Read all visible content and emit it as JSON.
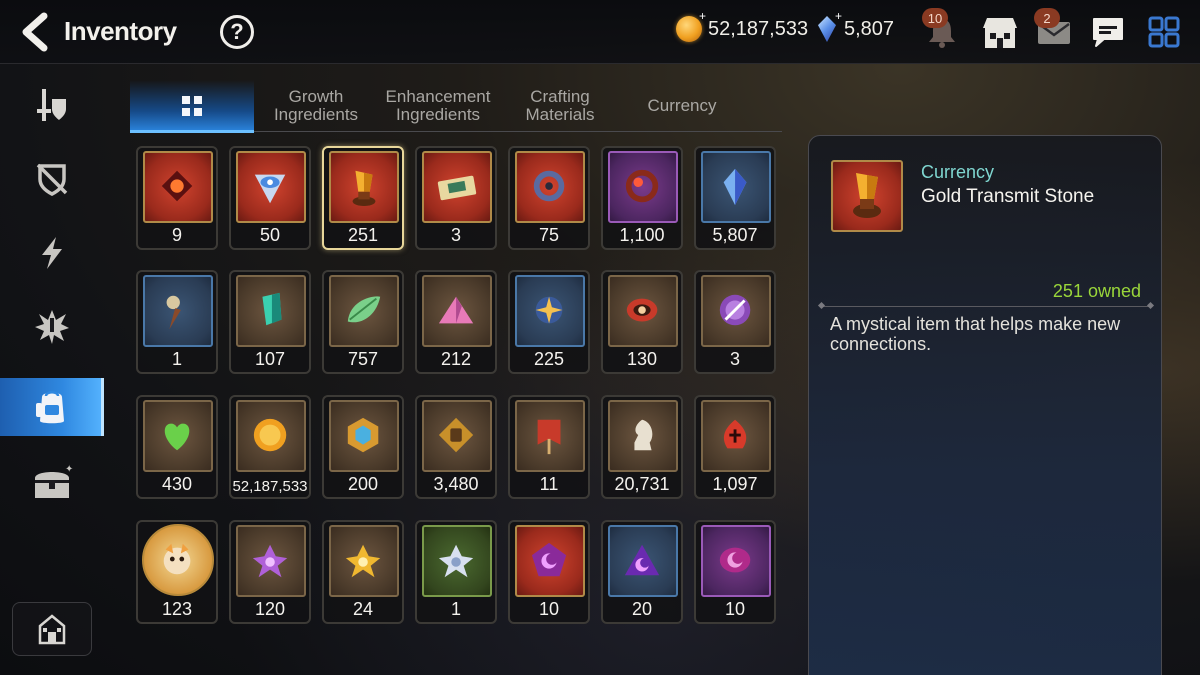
{
  "header": {
    "title": "Inventory",
    "help_label": "?",
    "gold": "52,187,533",
    "crystals": "5,807",
    "notifications_badge": "10",
    "mail_badge": "2",
    "icons": [
      "back-arrow-icon",
      "help-icon",
      "gold-coin-icon",
      "crystal-icon",
      "bell-icon",
      "shop-icon",
      "mail-icon",
      "chat-icon",
      "menu-grid-icon"
    ]
  },
  "sidebar": {
    "items": [
      {
        "icon": "sword-shield-icon"
      },
      {
        "icon": "broken-shield-icon"
      },
      {
        "icon": "lightning-icon"
      },
      {
        "icon": "burst-icon"
      },
      {
        "icon": "backpack-icon",
        "active": true
      },
      {
        "icon": "treasure-chest-icon"
      }
    ],
    "home_icon": "castle-icon"
  },
  "tabs": [
    {
      "label": "",
      "icon": "all-grid-icon",
      "active": true
    },
    {
      "label": "Growth\nIngredients"
    },
    {
      "label": "Enhancement\nIngredients"
    },
    {
      "label": "Crafting\nMaterials"
    },
    {
      "label": "Currency"
    }
  ],
  "items": [
    {
      "qty": "9",
      "frame": "red",
      "icon": "red-rune-icon"
    },
    {
      "qty": "50",
      "frame": "red",
      "icon": "eye-emblem-icon"
    },
    {
      "qty": "251",
      "frame": "red",
      "icon": "gold-transmit-stone-icon",
      "selected": true
    },
    {
      "qty": "3",
      "frame": "red",
      "icon": "ticket-icon"
    },
    {
      "qty": "75",
      "frame": "red",
      "icon": "ring-pendant-icon"
    },
    {
      "qty": "1,100",
      "frame": "purple",
      "icon": "flower-ring-icon"
    },
    {
      "qty": "5,807",
      "frame": "blue",
      "icon": "crystal-icon"
    },
    {
      "qty": "1",
      "frame": "blue",
      "icon": "compass-dagger-icon"
    },
    {
      "qty": "107",
      "frame": "brown",
      "icon": "teal-crystal-icon"
    },
    {
      "qty": "757",
      "frame": "brown",
      "icon": "leaf-icon"
    },
    {
      "qty": "212",
      "frame": "brown",
      "icon": "pink-mountain-icon"
    },
    {
      "qty": "225",
      "frame": "blue",
      "icon": "star-amulet-icon"
    },
    {
      "qty": "130",
      "frame": "brown",
      "icon": "red-bracelet-icon"
    },
    {
      "qty": "3",
      "frame": "brown",
      "icon": "purple-seal-icon"
    },
    {
      "qty": "430",
      "frame": "brown",
      "icon": "green-heart-icon"
    },
    {
      "qty": "52,187,533",
      "frame": "brown",
      "icon": "gold-sun-coin-icon",
      "small": true
    },
    {
      "qty": "200",
      "frame": "brown",
      "icon": "gold-hex-emblem-icon"
    },
    {
      "qty": "3,480",
      "frame": "brown",
      "icon": "fist-badge-icon"
    },
    {
      "qty": "11",
      "frame": "brown",
      "icon": "banner-icon"
    },
    {
      "qty": "20,731",
      "frame": "brown",
      "icon": "knight-chess-icon"
    },
    {
      "qty": "1,097",
      "frame": "brown",
      "icon": "flame-rune-icon"
    },
    {
      "qty": "123",
      "frame": "round",
      "icon": "mascot-portrait-icon"
    },
    {
      "qty": "120",
      "frame": "brown",
      "icon": "purple-lotus-icon"
    },
    {
      "qty": "24",
      "frame": "brown",
      "icon": "gold-lotus-icon"
    },
    {
      "qty": "1",
      "frame": "green",
      "icon": "silver-lotus-icon"
    },
    {
      "qty": "10",
      "frame": "red",
      "icon": "moon-pentagon-icon"
    },
    {
      "qty": "20",
      "frame": "blue",
      "icon": "moon-triangle-icon"
    },
    {
      "qty": "10",
      "frame": "purple",
      "icon": "moon-gem-icon"
    }
  ],
  "detail": {
    "category": "Currency",
    "name": "Gold Transmit Stone",
    "owned": "251 owned",
    "description": "A mystical item that helps make new connections.",
    "icon": "gold-transmit-stone-icon"
  },
  "colors": {
    "accent_blue": "#2f88e0",
    "owned_green": "#9ad63a",
    "category_teal": "#7fd6d0",
    "selected_border": "#e8d79a"
  }
}
